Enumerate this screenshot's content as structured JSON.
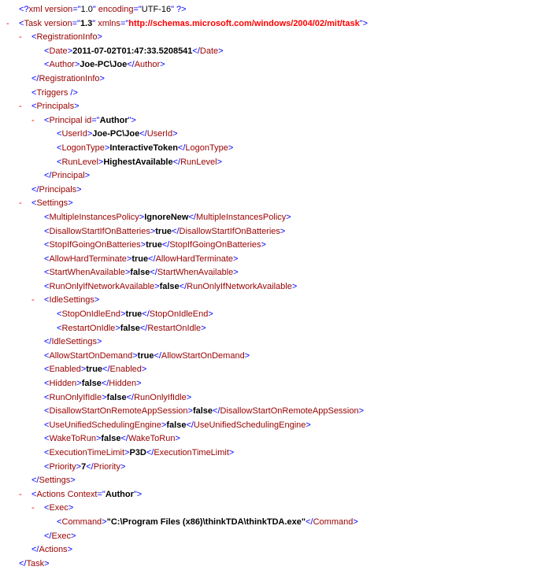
{
  "xmlDecl": {
    "version": "1.0",
    "encoding": "UTF-16"
  },
  "task": {
    "versionAttr": "1.3",
    "xmlns": "http://schemas.microsoft.com/windows/2004/02/mit/task"
  },
  "registrationInfo": {
    "date": "2011-07-02T01:47:33.5208541",
    "author": "Joe-PC\\Joe"
  },
  "principal": {
    "idAttr": "Author",
    "userId": "Joe-PC\\Joe",
    "logonType": "InteractiveToken",
    "runLevel": "HighestAvailable"
  },
  "settings": {
    "multipleInstancesPolicy": "IgnoreNew",
    "disallowStartIfOnBatteries": "true",
    "stopIfGoingOnBatteries": "true",
    "allowHardTerminate": "true",
    "startWhenAvailable": "false",
    "runOnlyIfNetworkAvailable": "false",
    "idle": {
      "stopOnIdleEnd": "true",
      "restartOnIdle": "false"
    },
    "allowStartOnDemand": "true",
    "enabled": "true",
    "hidden": "false",
    "runOnlyIfIdle": "false",
    "disallowStartOnRemoteAppSession": "false",
    "useUnifiedSchedulingEngine": "false",
    "wakeToRun": "false",
    "executionTimeLimit": "P3D",
    "priority": "7"
  },
  "actions": {
    "contextAttr": "Author",
    "exec": {
      "command": "\"C:\\Program Files (x86)\\thinkTDA\\thinkTDA.exe\""
    }
  }
}
